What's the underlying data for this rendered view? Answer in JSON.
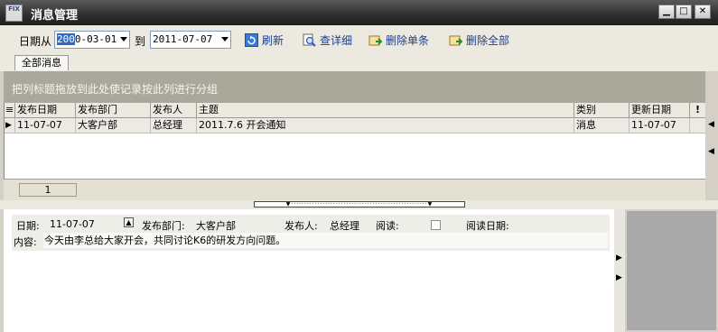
{
  "window": {
    "title": "消息管理",
    "icon_text": "FIX",
    "minimize_symbol": "▁",
    "maximize_symbol": "□",
    "close_symbol": "✕"
  },
  "toolbar": {
    "date_from_label": "日期从",
    "date_from_selected": "200",
    "date_from_rest": "0-03-01",
    "to_label": "到",
    "date_to_value": "2011-07-07",
    "refresh_label": "刷新",
    "detail_label": "查详细",
    "delete_one_label": "删除单条",
    "delete_all_label": "删除全部"
  },
  "tabs": [
    {
      "label": "全部消息"
    }
  ],
  "group_panel": {
    "hint": "把列标题拖放到此处使记录按此列进行分组"
  },
  "grid": {
    "row_indicator_header": "≡",
    "columns": [
      "发布日期",
      "发布部门",
      "发布人",
      "主题",
      "类别",
      "更新日期",
      "!"
    ],
    "rows": [
      {
        "indicator": "▶",
        "cells": [
          "11-07-07",
          "大客户部",
          "总经理",
          "2011.7.6 开会通知",
          "消息",
          "11-07-07",
          ""
        ]
      }
    ],
    "page_number": "1"
  },
  "detail": {
    "date_label": "日期:",
    "date_value": "11-07-07",
    "dept_label": "发布部门:",
    "dept_value": "大客户部",
    "publisher_label": "发布人:",
    "publisher_value": "总经理",
    "read_label": "阅读:",
    "read_checked": false,
    "read_date_label": "阅读日期:",
    "read_date_value": "",
    "content_label": "内容:",
    "content_value": "今天由李总给大家开会，共同讨论K6的研发方向问题。"
  },
  "colors": {
    "title_bar": "#2e2e2e",
    "toolbar_bg": "#ece9e0",
    "group_panel_bg": "#aaa89a",
    "link_text": "#1a3f8f",
    "selection": "#316ac5"
  }
}
